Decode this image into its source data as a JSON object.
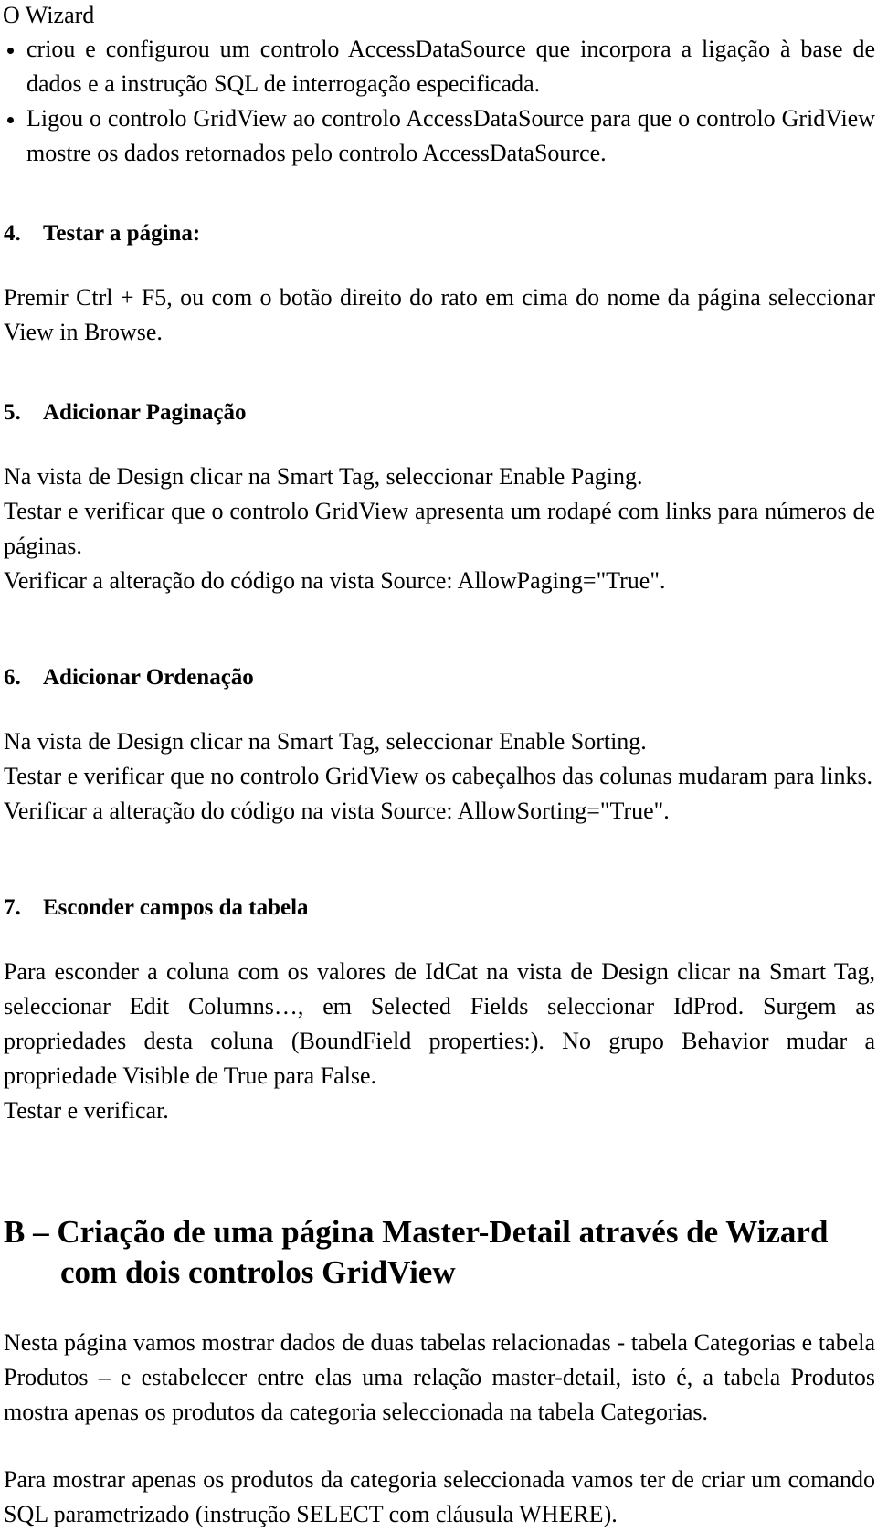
{
  "document": {
    "language": "pt-PT",
    "intro": {
      "lead": "O Wizard",
      "bullets": [
        "criou e configurou um controlo AccessDataSource que incorpora a ligação à base de dados e a instrução SQL de interrogação especificada.",
        "Ligou o controlo GridView ao controlo AccessDataSource para que o controlo GridView mostre os dados retornados pelo controlo AccessDataSource."
      ]
    },
    "sections": [
      {
        "number": "4.",
        "title": "Testar a página:",
        "paragraphs": [
          "Premir Ctrl + F5,  ou  com o botão direito do rato em cima do nome da página seleccionar View in Browse."
        ]
      },
      {
        "number": "5.",
        "title": "Adicionar Paginação",
        "paragraphs": [
          "Na vista de Design clicar na Smart Tag, seleccionar Enable Paging.",
          "Testar e verificar que o controlo GridView apresenta um rodapé com links para números de páginas.",
          "Verificar a alteração do código na vista Source: AllowPaging=\"True\"."
        ]
      },
      {
        "number": "6.",
        "title": "Adicionar Ordenação",
        "paragraphs": [
          "Na vista de Design clicar na Smart Tag, seleccionar Enable Sorting.",
          "Testar e verificar que no controlo GridView os cabeçalhos das colunas mudaram para links.",
          "Verificar a alteração do código na vista Source: AllowSorting=\"True\"."
        ]
      },
      {
        "number": "7.",
        "title": "Esconder campos da tabela",
        "paragraphs": [
          "Para esconder a coluna com os valores de IdCat na vista de Design clicar na Smart Tag, seleccionar Edit Columns…, em Selected Fields seleccionar IdProd. Surgem as propriedades desta coluna (BoundField properties:). No grupo Behavior mudar a propriedade Visible de True para False.",
          "Testar e verificar."
        ]
      }
    ],
    "section_b": {
      "line1": "B – Criação de uma página Master-Detail através de Wizard",
      "line2": "com dois controlos GridView",
      "paragraphs": [
        "Nesta página vamos mostrar dados de duas tabelas relacionadas - tabela Categorias e tabela Produtos – e estabelecer entre elas uma relação master-detail, isto é, a tabela Produtos mostra apenas os produtos da categoria seleccionada na tabela Categorias.",
        "Para mostrar apenas os produtos da categoria seleccionada vamos ter de criar um comando SQL parametrizado (instrução SELECT com cláusula WHERE)."
      ]
    }
  }
}
